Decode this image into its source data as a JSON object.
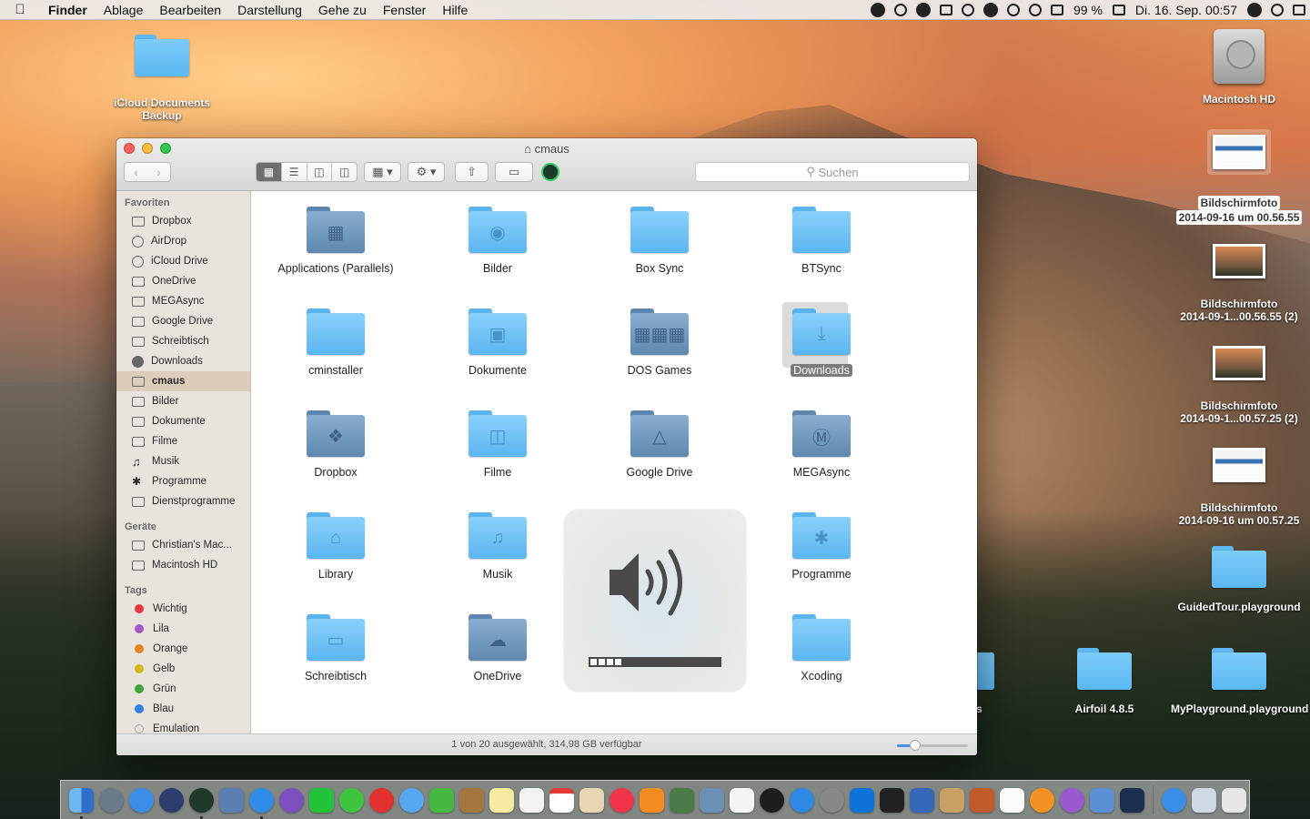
{
  "menubar": {
    "app_name": "Finder",
    "menus": [
      "Ablage",
      "Bearbeiten",
      "Darstellung",
      "Gehe zu",
      "Fenster",
      "Hilfe"
    ],
    "battery": "99 %",
    "clock": "Di. 16. Sep.  00:57"
  },
  "desktop": {
    "icloud": "iCloud Documents Backup",
    "macintosh_hd": "Macintosh HD",
    "shot1_line1": "Bildschirmfoto",
    "shot1_line2": "2014-09-16 um 00.56.55",
    "shot2_line1": "Bildschirmfoto",
    "shot2_line2": "2014-09-1...00.56.55 (2)",
    "shot3_line1": "Bildschirmfoto",
    "shot3_line2": "2014-09-1...00.57.25 (2)",
    "shot4_line1": "Bildschirmfoto",
    "shot4_line2": "2014-09-16 um 00.57.25",
    "guided_tour": "GuidedTour.playground",
    "partial": "s",
    "airfoil": "Airfoil 4.8.5",
    "myplayground": "MyPlayground.playground"
  },
  "window": {
    "title": "cmaus",
    "search_placeholder": "Suchen",
    "status": "1 von 20 ausgewählt, 314,98 GB verfügbar"
  },
  "sidebar": {
    "favorites_header": "Favoriten",
    "favorites": [
      "Dropbox",
      "AirDrop",
      "iCloud Drive",
      "OneDrive",
      "MEGAsync",
      "Google Drive",
      "Schreibtisch",
      "Downloads",
      "cmaus",
      "Bilder",
      "Dokumente",
      "Filme",
      "Musik",
      "Programme",
      "Dienstprogramme"
    ],
    "devices_header": "Geräte",
    "devices": [
      "Christian's Mac...",
      "Macintosh HD"
    ],
    "tags_header": "Tags",
    "tags": [
      {
        "label": "Wichtig",
        "color": "#e0393e"
      },
      {
        "label": "Lila",
        "color": "#a55bc6"
      },
      {
        "label": "Orange",
        "color": "#e7841f"
      },
      {
        "label": "Gelb",
        "color": "#d4b51a"
      },
      {
        "label": "Grün",
        "color": "#3fa53a"
      },
      {
        "label": "Blau",
        "color": "#2f82e0"
      },
      {
        "label": "Emulation",
        "color": "#c9c9c9"
      }
    ]
  },
  "files": [
    "Applications (Parallels)",
    "Bilder",
    "Box Sync",
    "BTSync",
    "cminstaller",
    "Dokumente",
    "DOS Games",
    "Downloads",
    "Dropbox",
    "Filme",
    "Google Drive",
    "MEGAsync",
    "Library",
    "Musik",
    "Programme",
    "Schreibtisch",
    "OneDrive",
    "Xcoding"
  ],
  "selected_file": "Downloads",
  "volume": {
    "level_segments": 4,
    "total_segments": 16
  }
}
